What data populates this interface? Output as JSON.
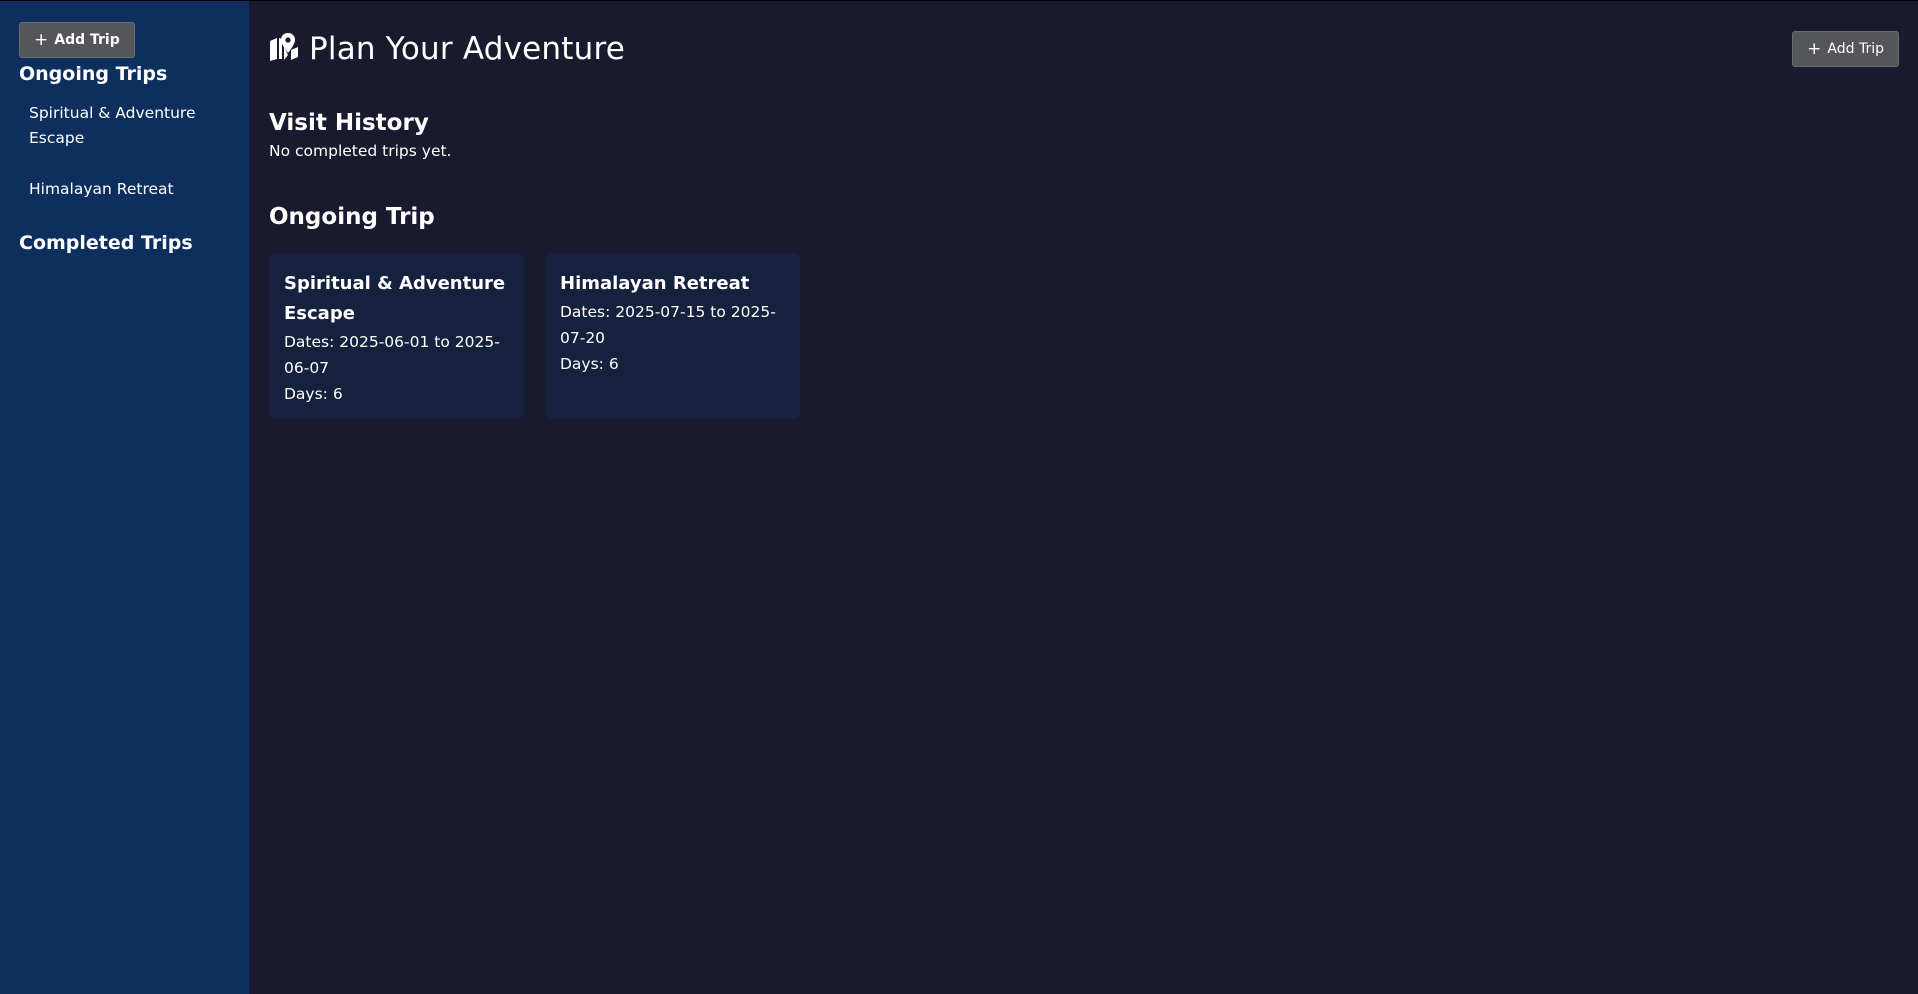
{
  "sidebar": {
    "add_button_label": "Add Trip",
    "ongoing_heading": "Ongoing Trips",
    "items": [
      {
        "label": "Spiritual & Adventure Escape"
      },
      {
        "label": "Himalayan Retreat"
      }
    ],
    "completed_heading": "Completed Trips"
  },
  "header": {
    "title": "Plan Your Adventure",
    "add_button_label": "Add Trip",
    "icon": "map-location-icon"
  },
  "visit_history": {
    "title": "Visit History",
    "empty_text": "No completed trips yet."
  },
  "ongoing": {
    "title": "Ongoing Trip",
    "trips": [
      {
        "name": "Spiritual & Adventure Escape",
        "dates": "Dates: 2025-06-01 to 2025-06-07",
        "days": "Days: 6"
      },
      {
        "name": "Himalayan Retreat",
        "dates": "Dates: 2025-07-15 to 2025-07-20",
        "days": "Days: 6"
      }
    ]
  },
  "colors": {
    "sidebar_bg": "#0e2f5e",
    "main_bg": "#1a1a2e",
    "card_bg": "#16213e",
    "button_bg": "#555659"
  }
}
